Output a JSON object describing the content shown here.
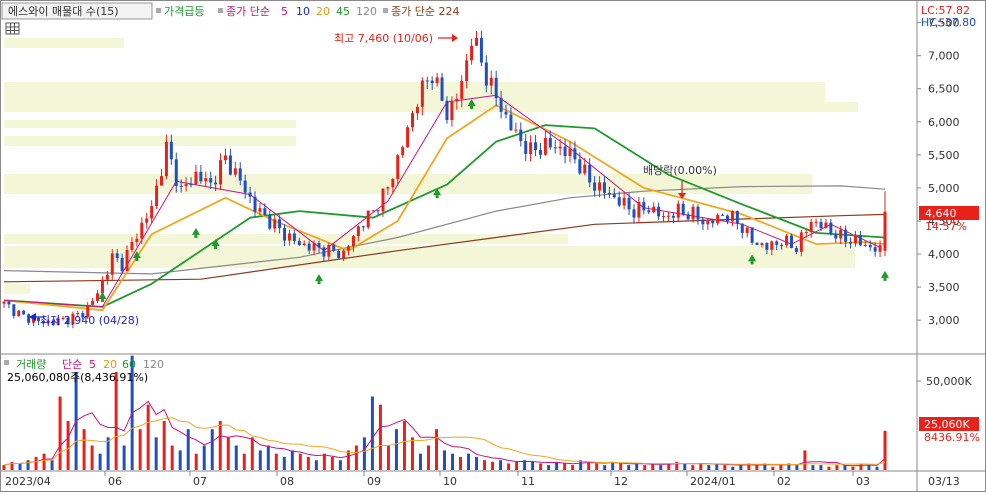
{
  "header": {
    "stock_label": "에스와이 매물대 수(15)",
    "surge_label": "가격급등",
    "ma_label": "종가 단순",
    "ma_periods": [
      "5",
      "10",
      "20",
      "45",
      "120"
    ],
    "ma224_label": "종가 단순 224",
    "lc_label": "LC:57.82",
    "hc_label": "HC:-37.80"
  },
  "annotations": {
    "high": "최고 7,460 (10/06)",
    "low": "최저 2,940 (04/28)",
    "dividend": "배당락(0.00%)"
  },
  "price_badge": {
    "price": "4,640",
    "change": "14.57%"
  },
  "volume_header": {
    "title": "거래량",
    "ma_label": "단순",
    "ma_periods": [
      "5",
      "20",
      "60",
      "120"
    ],
    "info": "25,060,080주(8,436.91%)"
  },
  "volume_badge": {
    "value": "25,060K",
    "change": "8436.91%"
  },
  "colors": {
    "up": "#e8221b",
    "down": "#1f4fc4",
    "ma5": "#c71585",
    "ma10": "#1f1fd0",
    "ma20": "#f0a81e",
    "ma45": "#1e9a2c",
    "ma120": "#8a8a8a",
    "ma224": "#8b3a1a",
    "volume_profile": "#f4f6d8"
  },
  "chart_data": {
    "type": "candlestick",
    "y_ticks": [
      "7,500",
      "7,000",
      "6,500",
      "6,000",
      "5,500",
      "5,000",
      "4,500",
      "4,000",
      "3,500",
      "3,000"
    ],
    "y_range": [
      2700,
      7600
    ],
    "volume_ticks": [
      "50,000K"
    ],
    "x_ticks": [
      "2023/04",
      "06",
      "07",
      "08",
      "09",
      "10",
      "11",
      "12",
      "2024/01",
      "02",
      "03",
      "03/13"
    ],
    "price_path": [
      [
        0,
        3250
      ],
      [
        4,
        3050
      ],
      [
        8,
        2960
      ],
      [
        12,
        3000
      ],
      [
        16,
        3100
      ],
      [
        19,
        3400
      ],
      [
        22,
        3950
      ],
      [
        24,
        3850
      ],
      [
        27,
        4300
      ],
      [
        30,
        4700
      ],
      [
        33,
        5600
      ],
      [
        36,
        4950
      ],
      [
        39,
        5200
      ],
      [
        42,
        5050
      ],
      [
        45,
        5450
      ],
      [
        48,
        5100
      ],
      [
        51,
        4700
      ],
      [
        54,
        4500
      ],
      [
        57,
        4300
      ],
      [
        60,
        4150
      ],
      [
        63,
        4100
      ],
      [
        66,
        4050
      ],
      [
        69,
        4000
      ],
      [
        72,
        4400
      ],
      [
        75,
        4650
      ],
      [
        78,
        5000
      ],
      [
        81,
        5650
      ],
      [
        84,
        6350
      ],
      [
        87,
        6750
      ],
      [
        90,
        6100
      ],
      [
        93,
        6550
      ],
      [
        95,
        7300
      ],
      [
        98,
        6700
      ],
      [
        101,
        6200
      ],
      [
        104,
        5800
      ],
      [
        107,
        5550
      ],
      [
        110,
        5650
      ],
      [
        113,
        5600
      ],
      [
        116,
        5450
      ],
      [
        119,
        5100
      ],
      [
        122,
        4950
      ],
      [
        125,
        4800
      ],
      [
        128,
        4650
      ],
      [
        131,
        4700
      ],
      [
        134,
        4550
      ],
      [
        137,
        4650
      ],
      [
        140,
        4600
      ],
      [
        143,
        4450
      ],
      [
        146,
        4600
      ],
      [
        149,
        4500
      ],
      [
        152,
        4200
      ],
      [
        155,
        4100
      ],
      [
        158,
        4200
      ],
      [
        161,
        4100
      ],
      [
        164,
        4500
      ],
      [
        167,
        4400
      ],
      [
        170,
        4250
      ],
      [
        173,
        4200
      ],
      [
        176,
        4100
      ],
      [
        178,
        4050
      ],
      [
        179,
        4640
      ]
    ],
    "ma5": [
      [
        0,
        3300
      ],
      [
        20,
        3200
      ],
      [
        35,
        5100
      ],
      [
        50,
        4900
      ],
      [
        65,
        4050
      ],
      [
        78,
        4800
      ],
      [
        90,
        6300
      ],
      [
        100,
        6400
      ],
      [
        115,
        5600
      ],
      [
        130,
        4700
      ],
      [
        150,
        4450
      ],
      [
        160,
        4150
      ],
      [
        168,
        4450
      ],
      [
        178,
        4100
      ]
    ],
    "ma20": [
      [
        0,
        3300
      ],
      [
        20,
        3150
      ],
      [
        30,
        4300
      ],
      [
        45,
        4850
      ],
      [
        55,
        4500
      ],
      [
        70,
        4050
      ],
      [
        80,
        4500
      ],
      [
        90,
        5750
      ],
      [
        100,
        6250
      ],
      [
        115,
        5700
      ],
      [
        130,
        5000
      ],
      [
        150,
        4600
      ],
      [
        165,
        4150
      ],
      [
        175,
        4180
      ],
      [
        179,
        4150
      ]
    ],
    "ma45": [
      [
        0,
        3300
      ],
      [
        20,
        3200
      ],
      [
        30,
        3550
      ],
      [
        50,
        4550
      ],
      [
        60,
        4650
      ],
      [
        75,
        4550
      ],
      [
        90,
        5050
      ],
      [
        100,
        5700
      ],
      [
        110,
        5950
      ],
      [
        120,
        5900
      ],
      [
        135,
        5200
      ],
      [
        150,
        4750
      ],
      [
        165,
        4320
      ],
      [
        179,
        4250
      ]
    ],
    "ma120": [
      [
        0,
        3750
      ],
      [
        30,
        3700
      ],
      [
        60,
        3950
      ],
      [
        80,
        4250
      ],
      [
        100,
        4650
      ],
      [
        115,
        4850
      ],
      [
        130,
        4950
      ],
      [
        150,
        5020
      ],
      [
        170,
        5030
      ],
      [
        179,
        4980
      ]
    ],
    "ma224": [
      [
        0,
        3580
      ],
      [
        40,
        3620
      ],
      [
        80,
        4050
      ],
      [
        120,
        4450
      ],
      [
        150,
        4530
      ],
      [
        170,
        4580
      ],
      [
        179,
        4600
      ]
    ],
    "volume": [
      3,
      5,
      4,
      6,
      8,
      10,
      6,
      45,
      30,
      60,
      25,
      15,
      10,
      20,
      60,
      15,
      70,
      25,
      40,
      20,
      30,
      15,
      12,
      25,
      10,
      15,
      25,
      30,
      20,
      15,
      10,
      20,
      12,
      15,
      10,
      8,
      12,
      10,
      8,
      6,
      10,
      8,
      6,
      12,
      15,
      20,
      45,
      40,
      15,
      25,
      30,
      20,
      10,
      15,
      25,
      12,
      10,
      8,
      10,
      8,
      6,
      5,
      6,
      4,
      5,
      6,
      5,
      4,
      3,
      5,
      4,
      3,
      6,
      5,
      4,
      3,
      5,
      4,
      3,
      4,
      3,
      4,
      3,
      4,
      5,
      4,
      3,
      4,
      3,
      4,
      3,
      2,
      3,
      4,
      3,
      4,
      2,
      3,
      4,
      3,
      12,
      3,
      3,
      2,
      3,
      3,
      2,
      4,
      3,
      2,
      24
    ],
    "volume_range": [
      0,
      60
    ]
  }
}
